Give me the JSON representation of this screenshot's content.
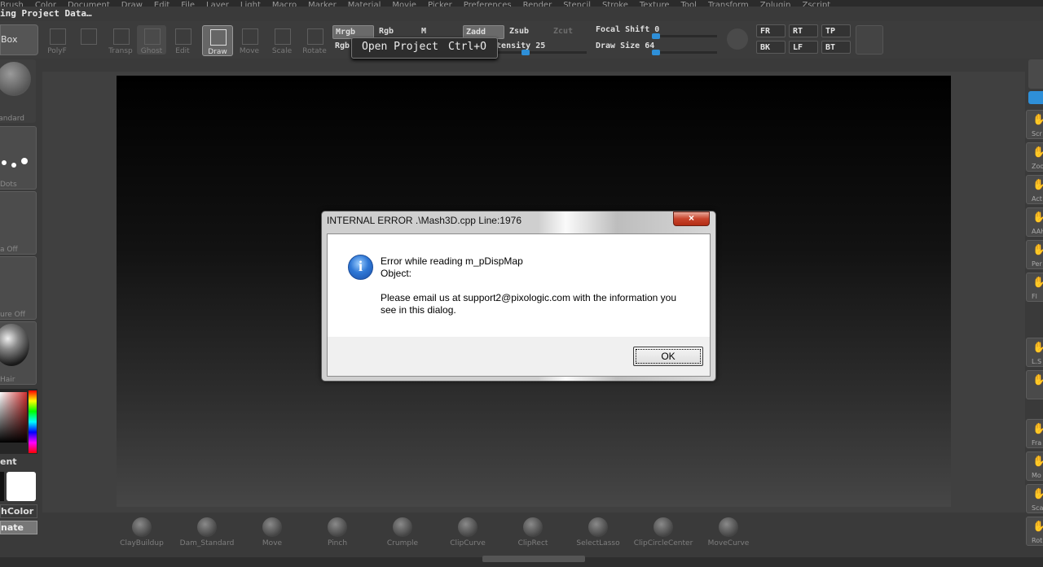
{
  "menu": [
    "Brush",
    "Color",
    "Document",
    "Draw",
    "Edit",
    "File",
    "Layer",
    "Light",
    "Macro",
    "Marker",
    "Material",
    "Movie",
    "Picker",
    "Preferences",
    "Render",
    "Stencil",
    "Stroke",
    "Texture",
    "Tool",
    "Transform",
    "Zplugin",
    "Zscript"
  ],
  "status_text": "ing Project Data…",
  "toolbar": {
    "box_label": "Box",
    "tools": [
      {
        "label": "PolyF",
        "icon": "polyframe-icon"
      },
      {
        "label": "",
        "icon": "cube-icon"
      },
      {
        "label": "Transp",
        "icon": "transparency-icon"
      },
      {
        "label": "Ghost",
        "icon": "ghost-icon"
      },
      {
        "label": "Edit",
        "icon": "edit-icon"
      },
      {
        "label": "Draw",
        "icon": "draw-icon"
      },
      {
        "label": "Move",
        "icon": "move-icon"
      },
      {
        "label": "Scale",
        "icon": "scale-icon"
      },
      {
        "label": "Rotate",
        "icon": "rotate-icon"
      }
    ],
    "mrgb": "Mrgb",
    "rgb": "Rgb",
    "m": "M",
    "zadd": "Zadd",
    "zsub": "Zsub",
    "zcut": "Zcut",
    "rgb_intensity_label": "Rgb",
    "intensity_label": "Intensity 25",
    "intensity": 25,
    "focal_shift_label": "Focal Shift 0",
    "focal_shift": 0,
    "draw_size_label": "Draw Size 64",
    "draw_size": 64,
    "views": [
      "FR",
      "RT",
      "TP",
      "BK",
      "LF",
      "BT"
    ]
  },
  "tooltip": {
    "text": "Open Project",
    "shortcut": "Ctrl+O"
  },
  "left_shelf": {
    "brush_label": "Standard",
    "stroke_label": "Dots",
    "alpha_label": "a Off",
    "texture_label": "ure Off",
    "material_label": "Hair",
    "gradient_label": "ent",
    "switch_color_label": "hColor",
    "alternate_label": "nate"
  },
  "right_shelf": [
    "Scr",
    "Zoo",
    "Act",
    "AAH",
    "Per",
    "Fl",
    "L.S",
    "",
    "Fra",
    "Mo",
    "Sca",
    "Rot"
  ],
  "brushes": [
    "ClayBuildup",
    "Dam_Standard",
    "Move",
    "Pinch",
    "Crumple",
    "ClipCurve",
    "ClipRect",
    "SelectLasso",
    "ClipCircleCenter",
    "MoveCurve"
  ],
  "dialog": {
    "title": "INTERNAL ERROR .\\Mash3D.cpp  Line:1976",
    "close": "×",
    "line1": "Error while reading m_pDispMap",
    "line2": "Object:",
    "line3": "Please email us at support2@pixologic.com with the information you",
    "line4": "see in this dialog.",
    "ok": "OK"
  }
}
